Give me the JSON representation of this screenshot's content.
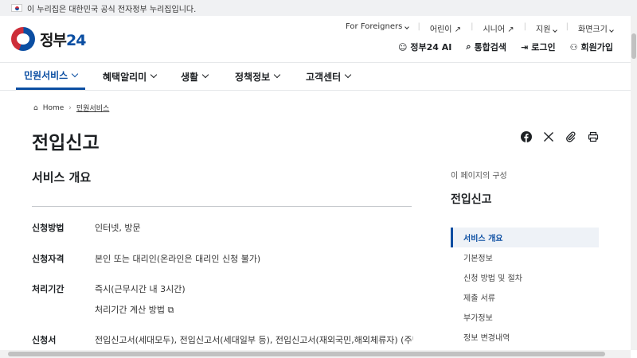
{
  "gov_banner": {
    "text": "이 누리집은 대한민국 공식 전자정부 누리집입니다."
  },
  "logo": {
    "text": "정부",
    "number": "24"
  },
  "utility_top": {
    "foreigners": "For Foreigners",
    "kids": "어린이",
    "senior": "시니어",
    "support": "지원",
    "screen_size": "화면크기"
  },
  "utility_bottom": {
    "ai": "정부24 AI",
    "search": "통합검색",
    "login": "로그인",
    "signup": "회원가입"
  },
  "gnb": {
    "items": [
      {
        "label": "민원서비스"
      },
      {
        "label": "혜택알리미"
      },
      {
        "label": "생활"
      },
      {
        "label": "정책정보"
      },
      {
        "label": "고객센터"
      }
    ]
  },
  "breadcrumb": {
    "home": "Home",
    "current": "민원서비스"
  },
  "page": {
    "title": "전입신고",
    "section_title": "서비스 개요"
  },
  "rows": {
    "method_label": "신청방법",
    "method_value": "인터넷, 방문",
    "eligibility_label": "신청자격",
    "eligibility_value": "본인 또는 대리인(온라인은 대리인 신청 불가)",
    "period_label": "처리기간",
    "period_value": "즉시(근무시간 내 3시간)",
    "period_calc": "처리기간 계산 방법",
    "form_label": "신청서",
    "form_value": "전입신고서(세대모두), 전입신고서(세대일부 등), 전입신고서(재외국민,해외체류자) (주민등록법"
  },
  "toc": {
    "caption": "이 페이지의 구성",
    "title": "전입신고",
    "items": [
      "서비스 개요",
      "기본정보",
      "신청 방법 및 절차",
      "제출 서류",
      "부가정보",
      "정보 변경내역"
    ]
  },
  "colors": {
    "accent": "#0b4ea2",
    "text": "#1e2124",
    "toc_active_bg": "#eef2f7"
  }
}
